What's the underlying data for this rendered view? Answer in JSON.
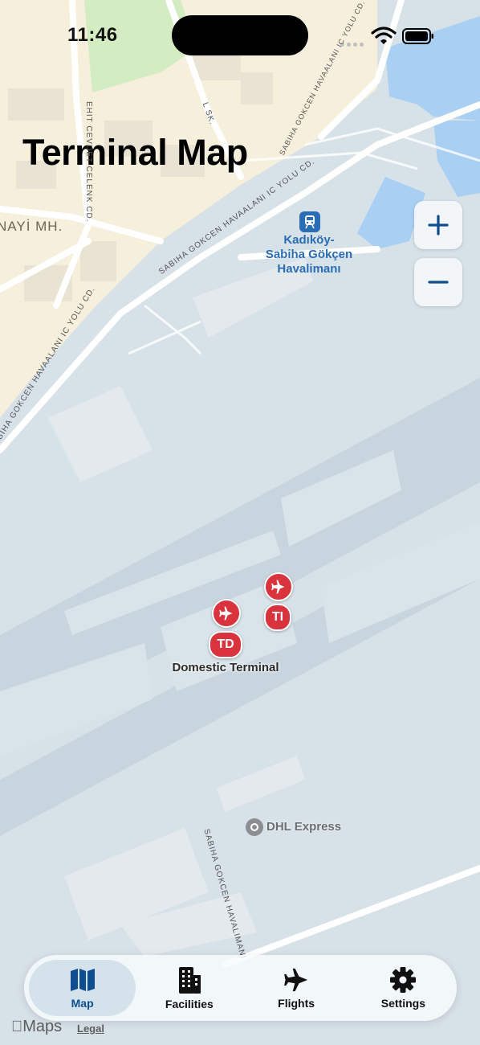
{
  "status_bar": {
    "time": "11:46"
  },
  "header": {
    "title": "Terminal Map"
  },
  "map": {
    "district_label": "NAYİ MH.",
    "station": {
      "name_line1": "Kadıköy-",
      "name_line2": "Sabiha Gökçen",
      "name_line3": "Havalimanı"
    },
    "terminal_markers": [
      {
        "label": "TI",
        "type": "international"
      },
      {
        "label": "TD",
        "type": "domestic"
      }
    ],
    "terminal_label": "Domestic Terminal",
    "poi_dhl": "DHL Express",
    "roads": [
      "SABIHA GOKCEN HAVAALANI IC YOLU CD.",
      "SABIHA GOKCEN HAVAALANI IC YOLU CD.",
      "SABIHA GOKCEN HAVAALANI IC YOLU CD.",
      "SABIHA GOKCEN HAVALIMANI",
      "EHIT CEVDET CELENK CD.",
      "L SK."
    ]
  },
  "zoom": {
    "in_icon": "plus-icon",
    "out_icon": "minus-icon"
  },
  "tabs": [
    {
      "label": "Map",
      "icon": "map-icon",
      "active": true
    },
    {
      "label": "Facilities",
      "icon": "building-icon",
      "active": false
    },
    {
      "label": "Flights",
      "icon": "airplane-icon",
      "active": false
    },
    {
      "label": "Settings",
      "icon": "gear-icon",
      "active": false
    }
  ],
  "footer": {
    "maps_brand": "Maps",
    "legal": "Legal"
  },
  "colors": {
    "accent": "#0e4d8f",
    "marker": "#d9343d",
    "station": "#2a6db7",
    "land": "#f5efdc",
    "airport": "#d7e1e8"
  }
}
